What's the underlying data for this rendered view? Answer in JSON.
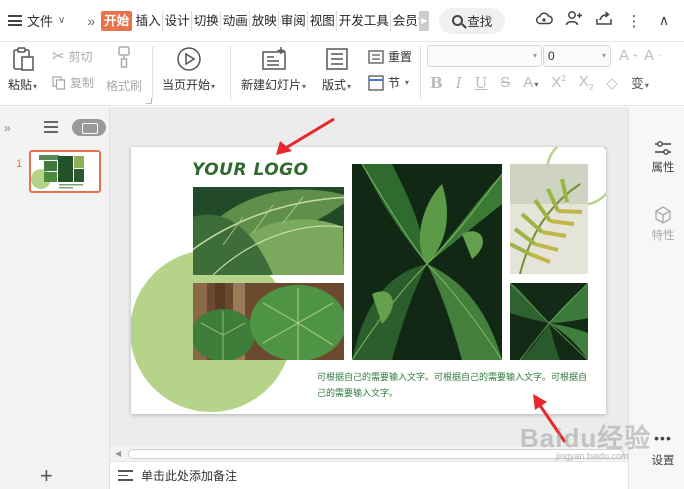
{
  "menubar": {
    "file_label": "文件",
    "tabs": [
      "开始",
      "插入",
      "设计",
      "切换",
      "动画",
      "放映",
      "审阅",
      "视图",
      "开发工具",
      "会员专"
    ],
    "active_tab": "开始",
    "search_label": "查找"
  },
  "ribbon": {
    "paste_label": "粘贴",
    "cut_label": "剪切",
    "copy_label": "复制",
    "format_painter_label": "格式刷",
    "from_current_label": "当页开始",
    "new_slide_label": "新建幻灯片",
    "layout_label": "版式",
    "reset_label": "重置",
    "section_label": "节",
    "font_name_value": "",
    "font_size_value": "0"
  },
  "thumbnails": {
    "slide_number": "1"
  },
  "slide": {
    "logo_text": "YOUR LOGO",
    "caption_text": "可根据自己的需要输入文字。可根据自己的需要输入文字。可根据自己的需要输入文字。"
  },
  "rightbar": {
    "properties_label": "属性",
    "features_label": "特性",
    "settings_label": "设置"
  },
  "notes": {
    "placeholder": "单击此处添加备注"
  },
  "watermark": {
    "text": "Baidu经验",
    "sub": "jingyan.baidu.com"
  },
  "colors": {
    "accent": "#e8734a",
    "slide_green": "#b5d48a",
    "logo_green": "#2f6b2d",
    "caption_green": "#2f7a3a",
    "annotation_red": "#e8262b"
  }
}
